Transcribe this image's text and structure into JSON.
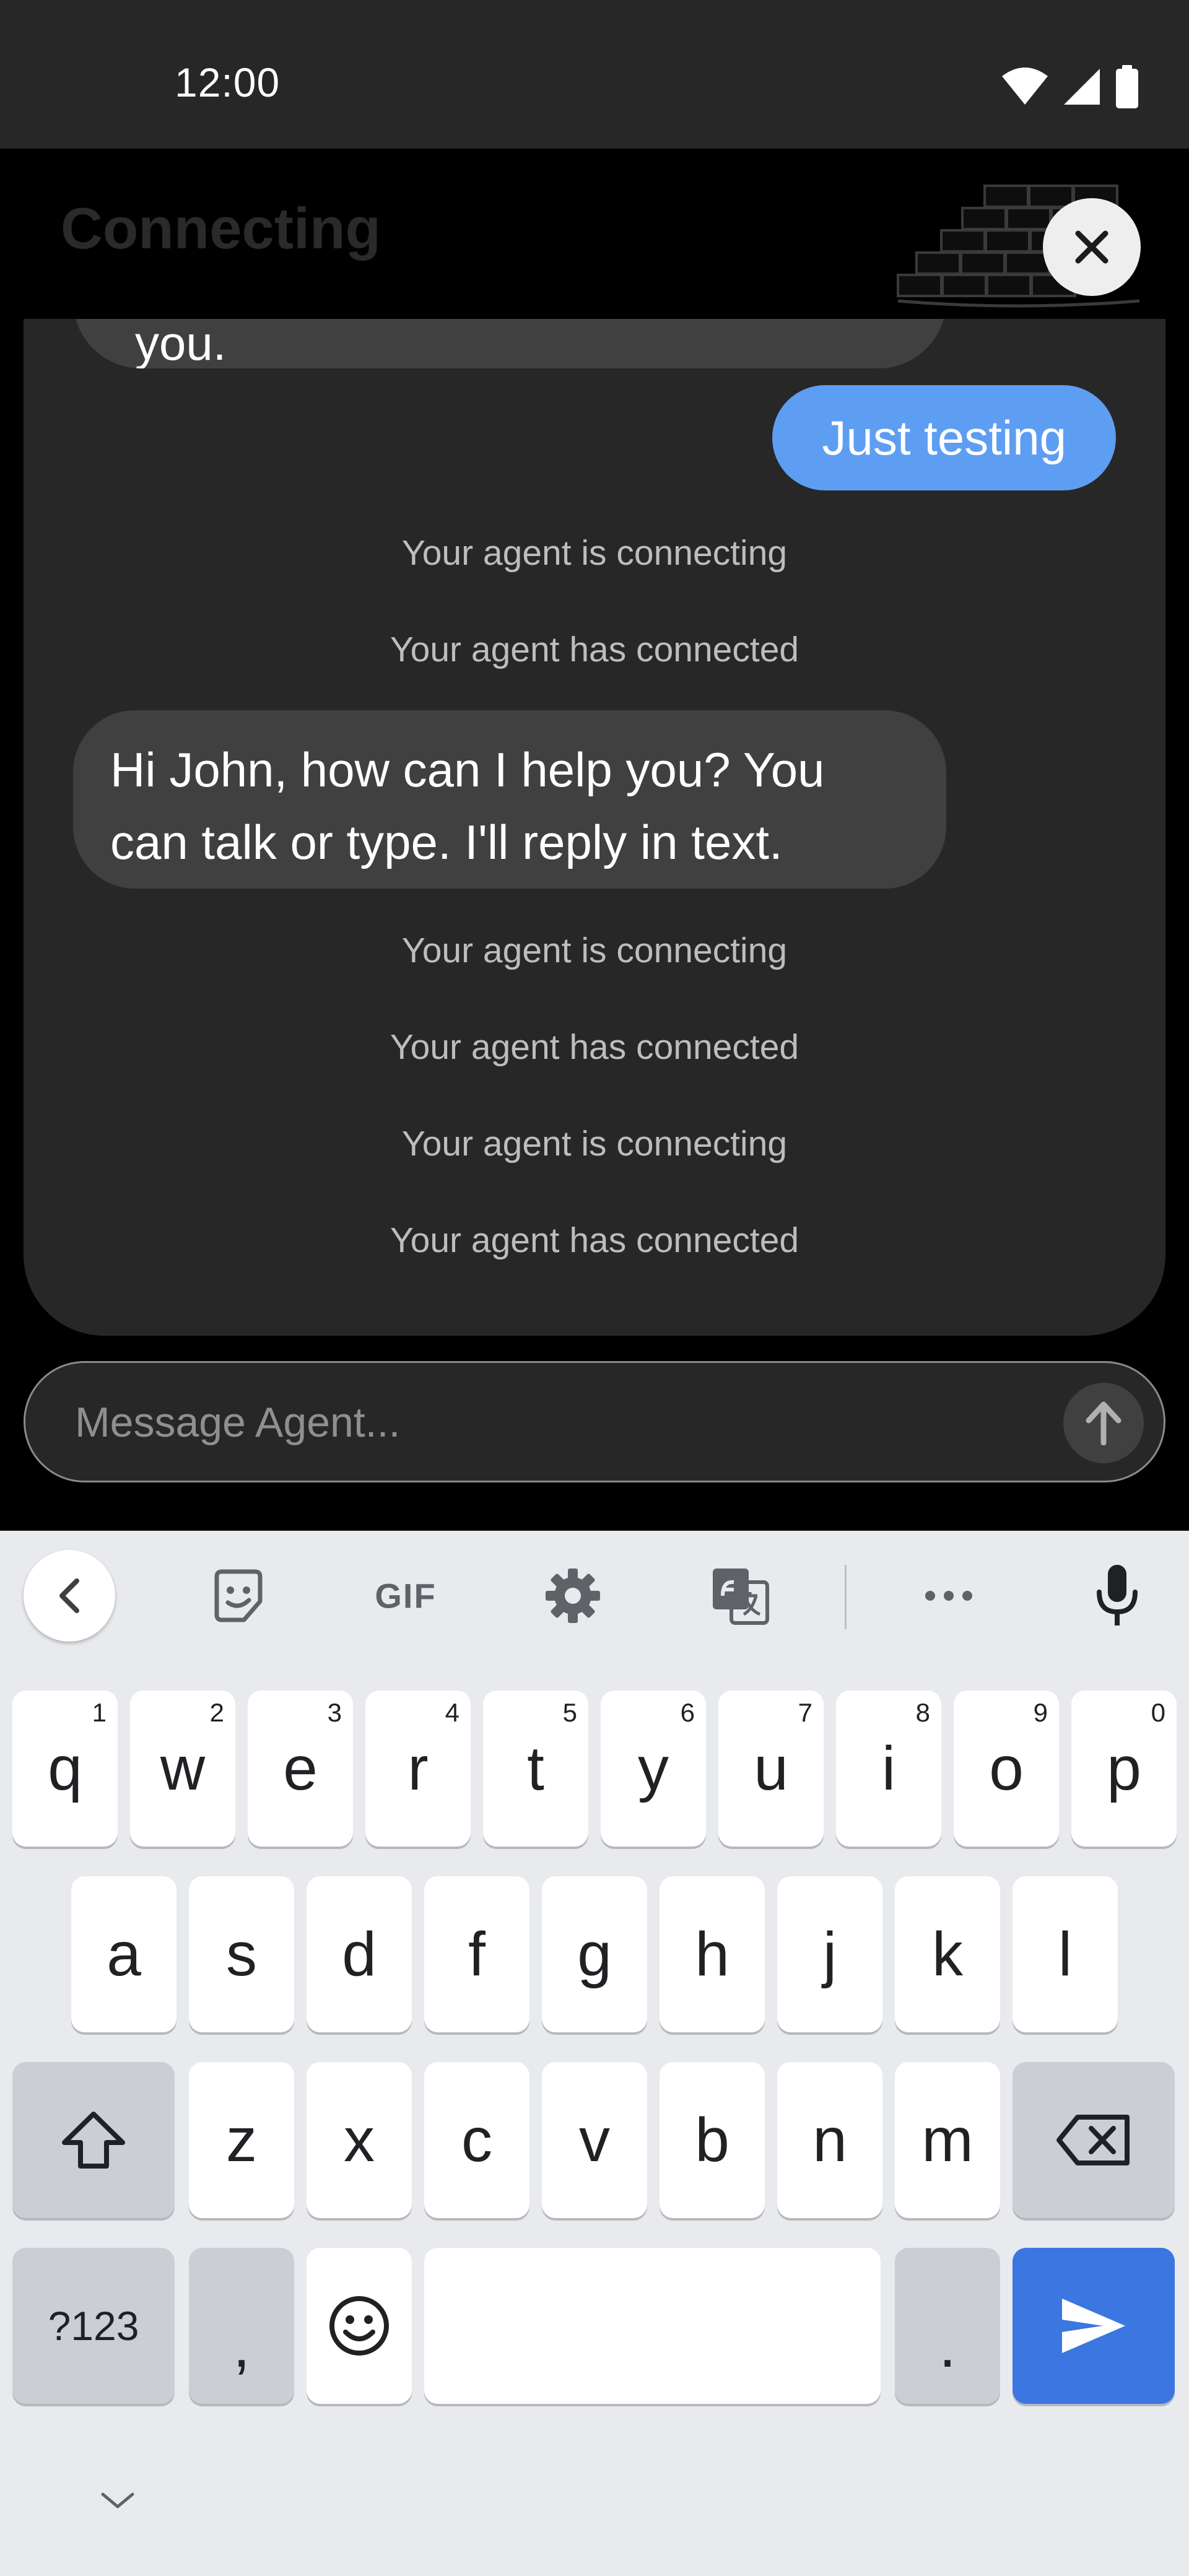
{
  "status_bar": {
    "time": "12:00",
    "icons": [
      "wifi-icon",
      "signal-icon",
      "battery-icon"
    ]
  },
  "background": {
    "title": "Connecting"
  },
  "chat": {
    "partial_message": "you.",
    "user_message": "Just testing",
    "system_1": "Your agent is connecting",
    "system_2": "Your agent has connected",
    "agent_message": "Hi John, how can I help you? You can talk or type. I'll reply in text.",
    "system_3": "Your agent is connecting",
    "system_4": "Your agent has connected",
    "system_5": "Your agent is connecting",
    "system_6": "Your agent has connected"
  },
  "composer": {
    "placeholder": "Message Agent...",
    "value": ""
  },
  "keyboard": {
    "toolbar": {
      "gif_label": "GIF"
    },
    "row1": [
      {
        "label": "q",
        "hint": "1"
      },
      {
        "label": "w",
        "hint": "2"
      },
      {
        "label": "e",
        "hint": "3"
      },
      {
        "label": "r",
        "hint": "4"
      },
      {
        "label": "t",
        "hint": "5"
      },
      {
        "label": "y",
        "hint": "6"
      },
      {
        "label": "u",
        "hint": "7"
      },
      {
        "label": "i",
        "hint": "8"
      },
      {
        "label": "o",
        "hint": "9"
      },
      {
        "label": "p",
        "hint": "0"
      }
    ],
    "row2": [
      "a",
      "s",
      "d",
      "f",
      "g",
      "h",
      "j",
      "k",
      "l"
    ],
    "row3": [
      "z",
      "x",
      "c",
      "v",
      "b",
      "n",
      "m"
    ],
    "symbols_label": "?123",
    "comma_label": ",",
    "period_label": "."
  },
  "colors": {
    "accent": "#5e9ef2",
    "enter_key": "#3b76e1",
    "panel": "#272727",
    "bubble": "#404040"
  }
}
